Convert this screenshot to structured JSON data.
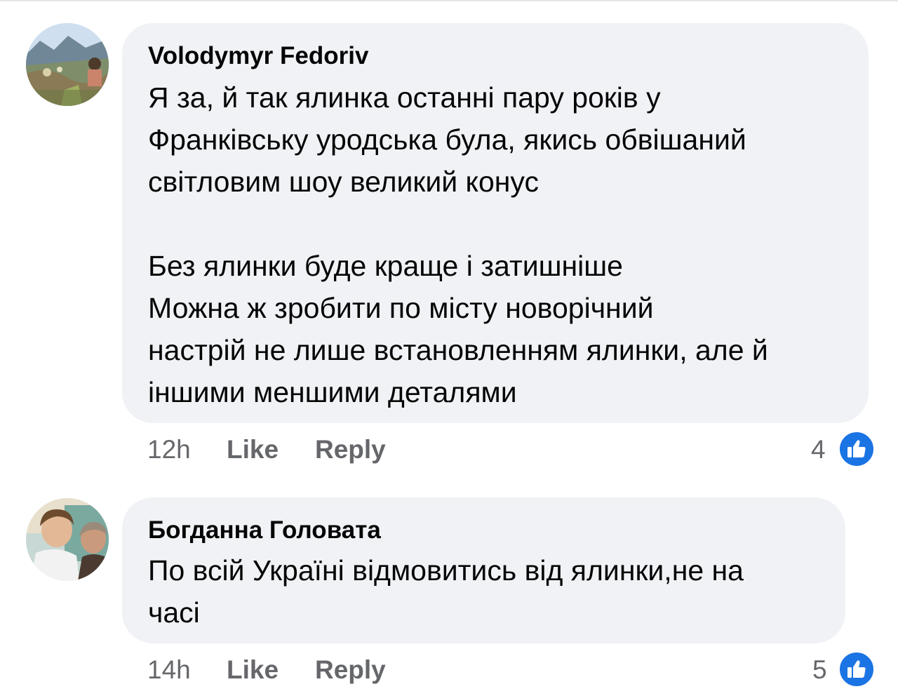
{
  "colors": {
    "bubble": "#f0f2f5",
    "text": "#050505",
    "meta": "#65676b",
    "like_badge": "#1b74e4"
  },
  "comments": [
    {
      "author": "Volodymyr Fedoriv",
      "avatar_icon": "landscape-photo-avatar",
      "lines": [
        "Я за, й так ялинка останні пару років у",
        "Франківську уродська була, якись обвішаний",
        "світловим шоу великий конус",
        "",
        "Без ялинки буде краще і затишніше",
        "Можна ж зробити по місту новорічний",
        "настрій не лише встановленням ялинки, але й",
        "іншими меншими деталями"
      ],
      "time": "12h",
      "like_label": "Like",
      "reply_label": "Reply",
      "reaction_count": "4",
      "reaction_icon": "thumbs-up-icon"
    },
    {
      "author": "Богданна Головата",
      "avatar_icon": "people-photo-avatar",
      "lines": [
        "По всій Україні відмовитись від ялинки,не на",
        "часі"
      ],
      "time": "14h",
      "like_label": "Like",
      "reply_label": "Reply",
      "reaction_count": "5",
      "reaction_icon": "thumbs-up-icon"
    }
  ]
}
